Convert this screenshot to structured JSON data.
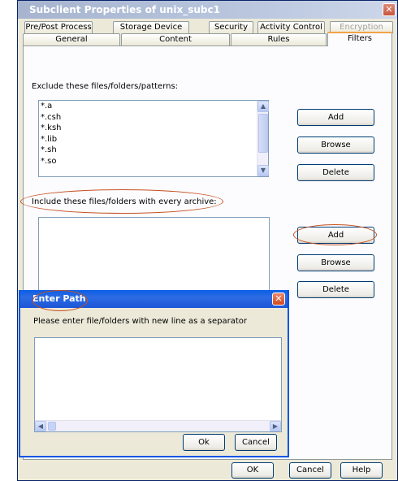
{
  "window": {
    "title": "Subclient Properties of unix_subc1",
    "close_glyph": "✕"
  },
  "tabs": {
    "row1": [
      "Pre/Post Process",
      "Storage Device",
      "Security",
      "Activity Control",
      "Encryption"
    ],
    "row2": [
      "General",
      "Content",
      "Rules",
      "Filters"
    ],
    "active": "Filters",
    "disabled": "Encryption"
  },
  "exclude": {
    "label": "Exclude these files/folders/patterns:",
    "items": [
      "*.a",
      "*.csh",
      "*.ksh",
      "*.lib",
      "*.sh",
      "*.so"
    ],
    "add_label": "Add",
    "browse_label": "Browse",
    "delete_label": "Delete"
  },
  "include": {
    "label": "Include these files/folders with every archive:",
    "add_label": "Add",
    "browse_label": "Browse",
    "delete_label": "Delete"
  },
  "dialog": {
    "title": "Enter Path",
    "close_glyph": "✕",
    "instruction": "Please enter file/folders with new line as a separator",
    "ok_label": "Ok",
    "cancel_label": "Cancel"
  },
  "footer": {
    "ok_label": "OK",
    "cancel_label": "Cancel",
    "help_label": "Help"
  },
  "scroll_glyphs": {
    "up": "▲",
    "down": "▼",
    "left": "◀",
    "right": "▶"
  },
  "colors": {
    "highlight_oval": "#c6501f",
    "dialog_titlebar": "#0a5fe8",
    "active_tab_accent": "#f2a24a"
  },
  "icons": [
    "close-icon",
    "scroll-up-icon",
    "scroll-down-icon",
    "scroll-left-icon",
    "scroll-right-icon"
  ]
}
